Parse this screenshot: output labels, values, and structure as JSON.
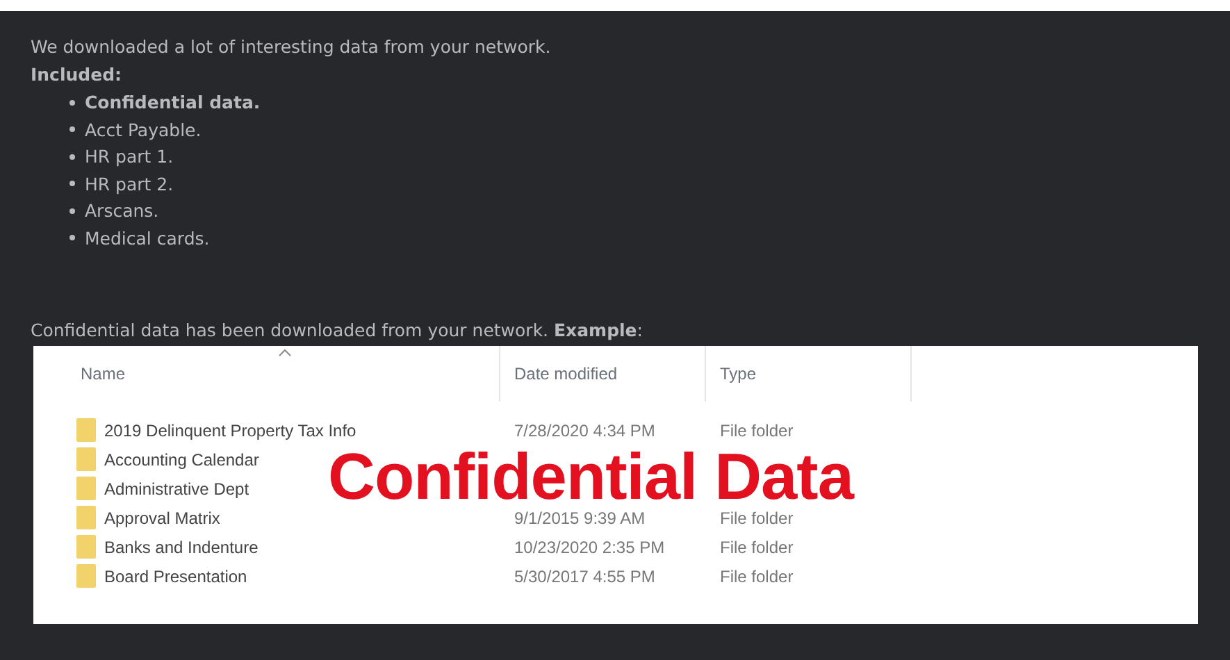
{
  "intro": "We downloaded a lot of interesting data from your network.",
  "included_label": "Included:",
  "items": [
    {
      "text": "Confidential data.",
      "bold": true
    },
    {
      "text": "Acct Payable.",
      "bold": false
    },
    {
      "text": "HR part 1.",
      "bold": false
    },
    {
      "text": "HR part 2.",
      "bold": false
    },
    {
      "text": "Arscans.",
      "bold": false
    },
    {
      "text": "Medical cards.",
      "bold": false
    }
  ],
  "example_line": "Confidential data has been downloaded from your network. **Example**:",
  "explorer": {
    "columns": [
      "Name",
      "Date modified",
      "Type"
    ],
    "rows": [
      {
        "name": "2019 Delinquent Property Tax Info",
        "date": "7/28/2020 4:34 PM",
        "type": "File folder"
      },
      {
        "name": "Accounting Calendar"
      },
      {
        "name": "Administrative Dept"
      },
      {
        "name": "Approval Matrix",
        "date": "9/1/2015 9:39 AM",
        "type": "File folder"
      },
      {
        "name": "Banks and Indenture",
        "date": "10/23/2020 2:35 PM",
        "type": "File folder"
      },
      {
        "name": "Board Presentation",
        "date": "5/30/2017 4:55 PM",
        "type": "File folder"
      }
    ]
  },
  "overlay": "Confidential Data"
}
